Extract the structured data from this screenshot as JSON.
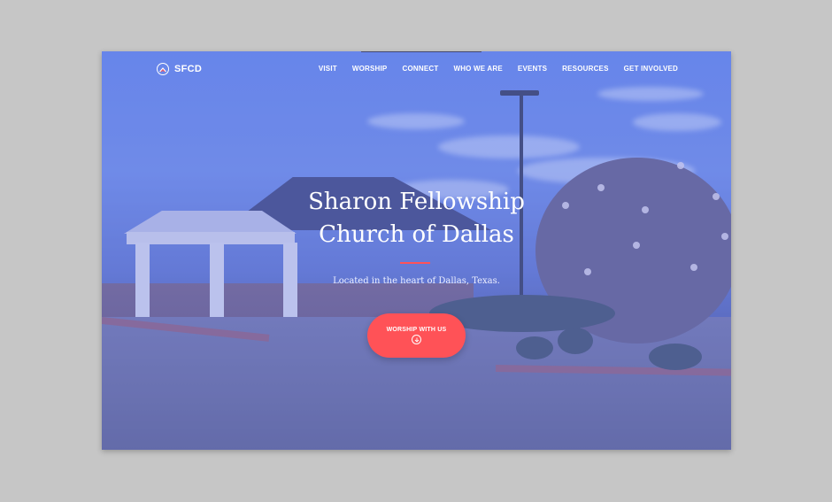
{
  "header": {
    "logo_text": "SFCD",
    "logo_icon": "church-roof-logo-icon"
  },
  "nav": {
    "items": [
      {
        "label": "VISIT"
      },
      {
        "label": "WORSHIP"
      },
      {
        "label": "CONNECT"
      },
      {
        "label": "WHO WE ARE"
      },
      {
        "label": "EVENTS"
      },
      {
        "label": "RESOURCES"
      },
      {
        "label": "GET INVOLVED"
      }
    ]
  },
  "hero": {
    "title_line1": "Sharon Fellowship",
    "title_line2": "Church of Dallas",
    "subtitle": "Located in the heart of Dallas, Texas.",
    "cta_label": "WORSHIP WITH US",
    "cta_icon": "arrow-down-circle-icon"
  },
  "colors": {
    "accent": "#ff5257",
    "overlay": "#546cdc",
    "page_background": "#c6c6c6"
  }
}
